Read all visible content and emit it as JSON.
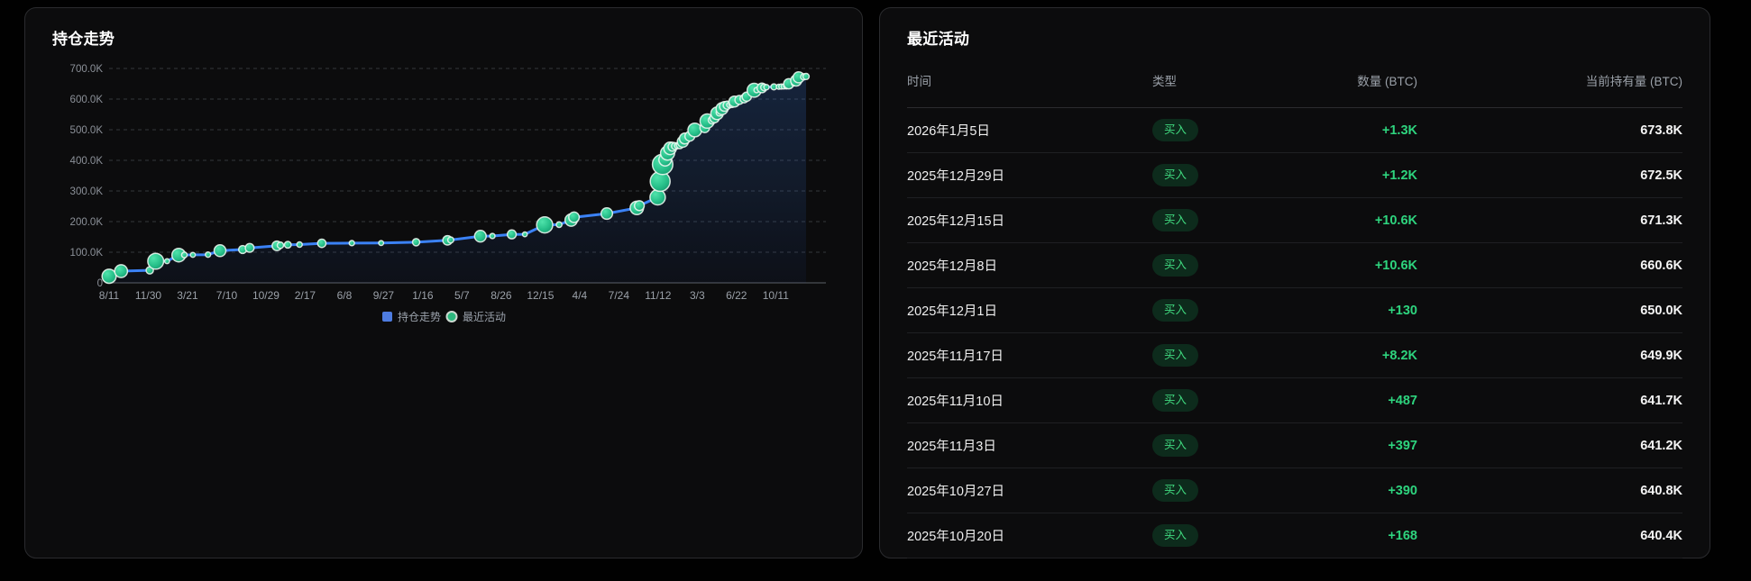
{
  "left_panel": {
    "title": "持仓走势"
  },
  "right_panel": {
    "title": "最近活动",
    "table": {
      "columns": [
        "时间",
        "类型",
        "数量 (BTC)",
        "当前持有量 (BTC)"
      ],
      "rows": [
        {
          "date": "2026年1月5日",
          "type": "买入",
          "amount": "+1.3K",
          "holdings": "673.8K"
        },
        {
          "date": "2025年12月29日",
          "type": "买入",
          "amount": "+1.2K",
          "holdings": "672.5K"
        },
        {
          "date": "2025年12月15日",
          "type": "买入",
          "amount": "+10.6K",
          "holdings": "671.3K"
        },
        {
          "date": "2025年12月8日",
          "type": "买入",
          "amount": "+10.6K",
          "holdings": "660.6K"
        },
        {
          "date": "2025年12月1日",
          "type": "买入",
          "amount": "+130",
          "holdings": "650.0K"
        },
        {
          "date": "2025年11月17日",
          "type": "买入",
          "amount": "+8.2K",
          "holdings": "649.9K"
        },
        {
          "date": "2025年11月10日",
          "type": "买入",
          "amount": "+487",
          "holdings": "641.7K"
        },
        {
          "date": "2025年11月3日",
          "type": "买入",
          "amount": "+397",
          "holdings": "641.2K"
        },
        {
          "date": "2025年10月27日",
          "type": "买入",
          "amount": "+390",
          "holdings": "640.8K"
        },
        {
          "date": "2025年10月20日",
          "type": "买入",
          "amount": "+168",
          "holdings": "640.4K"
        }
      ]
    }
  },
  "chart_data": {
    "type": "line",
    "title": "持仓走势",
    "legend": [
      "持仓走势",
      "最近活动"
    ],
    "legend_colors": {
      "line": "#4e7ce0",
      "activity": "#2db87e"
    },
    "ylim_btc": [
      0,
      700000
    ],
    "y_ticks": [
      "0",
      "100.0K",
      "200.0K",
      "300.0K",
      "400.0K",
      "500.0K",
      "600.0K",
      "700.0K"
    ],
    "x_ticks": [
      "8/11",
      "11/30",
      "3/21",
      "7/10",
      "10/29",
      "2/17",
      "6/8",
      "9/27",
      "1/16",
      "5/7",
      "8/26",
      "12/15",
      "4/4",
      "7/24",
      "11/12",
      "3/3",
      "6/22",
      "10/11"
    ],
    "x_range": [
      "2020-08-11",
      "2026-01-05"
    ],
    "x_ticks_end": "2025-10-11",
    "grid": "dashed",
    "legend_position": "bottom",
    "colors": {
      "line": "#3b82f6",
      "bubble": "#27c08a",
      "area_top": "#3b82f6"
    },
    "series": [
      {
        "name": "持仓走势",
        "kind": "line+bubbles",
        "units": "K BTC",
        "points": [
          [
            "2020-08-11",
            21.5
          ],
          [
            "2020-09-14",
            38.3
          ],
          [
            "2020-12-04",
            40.8
          ],
          [
            "2020-12-21",
            70.5
          ],
          [
            "2021-01-22",
            70.8
          ],
          [
            "2021-02-24",
            90.5
          ],
          [
            "2021-03-12",
            91.3
          ],
          [
            "2021-04-05",
            91.6
          ],
          [
            "2021-05-18",
            92.1
          ],
          [
            "2021-06-21",
            105.1
          ],
          [
            "2021-08-24",
            108.9
          ],
          [
            "2021-09-13",
            114.0
          ],
          [
            "2021-11-29",
            121.0
          ],
          [
            "2021-12-09",
            122.5
          ],
          [
            "2021-12-30",
            124.4
          ],
          [
            "2022-02-01",
            125.0
          ],
          [
            "2022-04-05",
            129.2
          ],
          [
            "2022-06-29",
            129.7
          ],
          [
            "2022-09-20",
            130.0
          ],
          [
            "2022-12-28",
            132.5
          ],
          [
            "2023-03-27",
            138.9
          ],
          [
            "2023-04-05",
            140.0
          ],
          [
            "2023-06-28",
            152.3
          ],
          [
            "2023-08-01",
            152.8
          ],
          [
            "2023-09-25",
            158.2
          ],
          [
            "2023-11-01",
            158.4
          ],
          [
            "2023-12-27",
            189.2
          ],
          [
            "2024-02-06",
            190.0
          ],
          [
            "2024-03-11",
            205.0
          ],
          [
            "2024-03-19",
            214.2
          ],
          [
            "2024-06-20",
            226.3
          ],
          [
            "2024-09-13",
            244.8
          ],
          [
            "2024-09-20",
            252.2
          ],
          [
            "2024-11-11",
            279.4
          ],
          [
            "2024-11-18",
            331.2
          ],
          [
            "2024-11-25",
            386.7
          ],
          [
            "2024-12-02",
            402.1
          ],
          [
            "2024-12-09",
            423.7
          ],
          [
            "2024-12-16",
            439.0
          ],
          [
            "2024-12-23",
            444.3
          ],
          [
            "2024-12-30",
            446.4
          ],
          [
            "2025-01-06",
            447.5
          ],
          [
            "2025-01-13",
            450.0
          ],
          [
            "2025-01-21",
            461.0
          ],
          [
            "2025-01-27",
            471.1
          ],
          [
            "2025-02-10",
            478.7
          ],
          [
            "2025-02-24",
            499.1
          ],
          [
            "2025-03-24",
            506.1
          ],
          [
            "2025-03-31",
            528.2
          ],
          [
            "2025-04-14",
            531.6
          ],
          [
            "2025-04-21",
            538.2
          ],
          [
            "2025-04-28",
            553.6
          ],
          [
            "2025-05-05",
            555.5
          ],
          [
            "2025-05-12",
            568.8
          ],
          [
            "2025-05-19",
            576.2
          ],
          [
            "2025-05-27",
            580.2
          ],
          [
            "2025-06-02",
            580.9
          ],
          [
            "2025-06-09",
            582.0
          ],
          [
            "2025-06-16",
            592.1
          ],
          [
            "2025-06-30",
            597.3
          ],
          [
            "2025-07-14",
            601.5
          ],
          [
            "2025-07-21",
            607.8
          ],
          [
            "2025-08-11",
            628.9
          ],
          [
            "2025-08-18",
            629.4
          ],
          [
            "2025-09-02",
            636.5
          ],
          [
            "2025-09-08",
            638.4
          ],
          [
            "2025-09-15",
            638.9
          ],
          [
            "2025-10-06",
            640.0
          ],
          [
            "2025-10-20",
            640.4
          ],
          [
            "2025-10-27",
            640.8
          ],
          [
            "2025-11-03",
            641.2
          ],
          [
            "2025-11-10",
            641.7
          ],
          [
            "2025-11-17",
            649.9
          ],
          [
            "2025-12-01",
            650.0
          ],
          [
            "2025-12-08",
            660.6
          ],
          [
            "2025-12-15",
            671.3
          ],
          [
            "2025-12-29",
            672.5
          ],
          [
            "2026-01-05",
            673.8
          ]
        ]
      }
    ]
  }
}
